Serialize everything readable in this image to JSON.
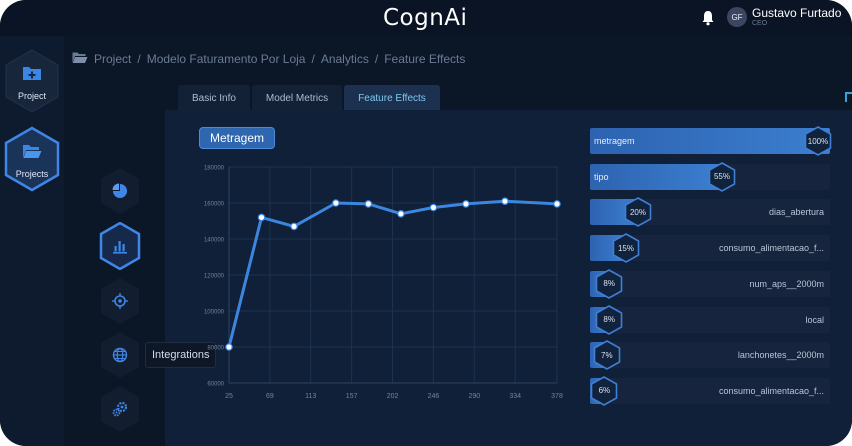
{
  "app": {
    "logo": "CognAi"
  },
  "header": {
    "avatar_initials": "GF",
    "user_name": "Gustavo Furtado",
    "user_role": "CEO"
  },
  "sidebar": {
    "items": [
      {
        "label": "Project",
        "icon": "folder-plus-icon"
      },
      {
        "label": "Projects",
        "icon": "folder-open-icon"
      }
    ]
  },
  "breadcrumb": {
    "icon": "folder-open-icon",
    "parts": [
      "Project",
      "Modelo Faturamento Por Loja",
      "Analytics",
      "Feature Effects"
    ]
  },
  "tabs": [
    {
      "label": "Basic Info",
      "active": false
    },
    {
      "label": "Model Metrics",
      "active": false
    },
    {
      "label": "Feature Effects",
      "active": true
    }
  ],
  "subnav": {
    "items": [
      {
        "icon": "pie-chart-icon"
      },
      {
        "icon": "bar-chart-icon",
        "active": true
      },
      {
        "icon": "crosshair-icon"
      },
      {
        "icon": "globe-icon"
      },
      {
        "icon": "gears-icon"
      }
    ],
    "tooltip": "Integrations"
  },
  "feature_title": "Metragem",
  "chart_data": {
    "type": "line",
    "x": [
      25,
      69,
      113,
      157,
      201,
      245,
      289,
      333,
      378
    ],
    "x_points": [
      25,
      60,
      95,
      140,
      175,
      210,
      245,
      280,
      322,
      378
    ],
    "y_points": [
      80000,
      152000,
      147000,
      160000,
      159500,
      154000,
      157500,
      159500,
      161000,
      159500
    ],
    "ylim": [
      60000,
      180000
    ],
    "xlim": [
      25,
      378
    ],
    "yticks": [
      60000,
      80000,
      100000,
      120000,
      140000,
      160000,
      180000
    ],
    "ytick_labels": [
      "60000",
      "80000",
      "100000",
      "120000",
      "140000",
      "160000",
      "180000"
    ],
    "xtick_labels": [
      "25",
      "69",
      "113",
      "157",
      "202",
      "246",
      "290",
      "334",
      "378"
    ],
    "grid": true,
    "line_color": "#3c86e0",
    "marker_color": "#ffffff"
  },
  "feature_importance": [
    {
      "name": "metragem",
      "value": 100,
      "label": "100%"
    },
    {
      "name": "tipo",
      "value": 55,
      "label": "55%"
    },
    {
      "name": "dias_abertura",
      "value": 20,
      "label": "20%"
    },
    {
      "name": "consumo_alimentacao_f...",
      "value": 15,
      "label": "15%"
    },
    {
      "name": "num_aps__2000m",
      "value": 8,
      "label": "8%"
    },
    {
      "name": "local",
      "value": 8,
      "label": "8%"
    },
    {
      "name": "lanchonetes__2000m",
      "value": 7,
      "label": "7%"
    },
    {
      "name": "consumo_alimentacao_f...",
      "value": 6,
      "label": "6%"
    }
  ],
  "colors": {
    "accent": "#3c86e0",
    "bar": "#2d63b0",
    "hex_stroke": "#3f7fd6"
  }
}
